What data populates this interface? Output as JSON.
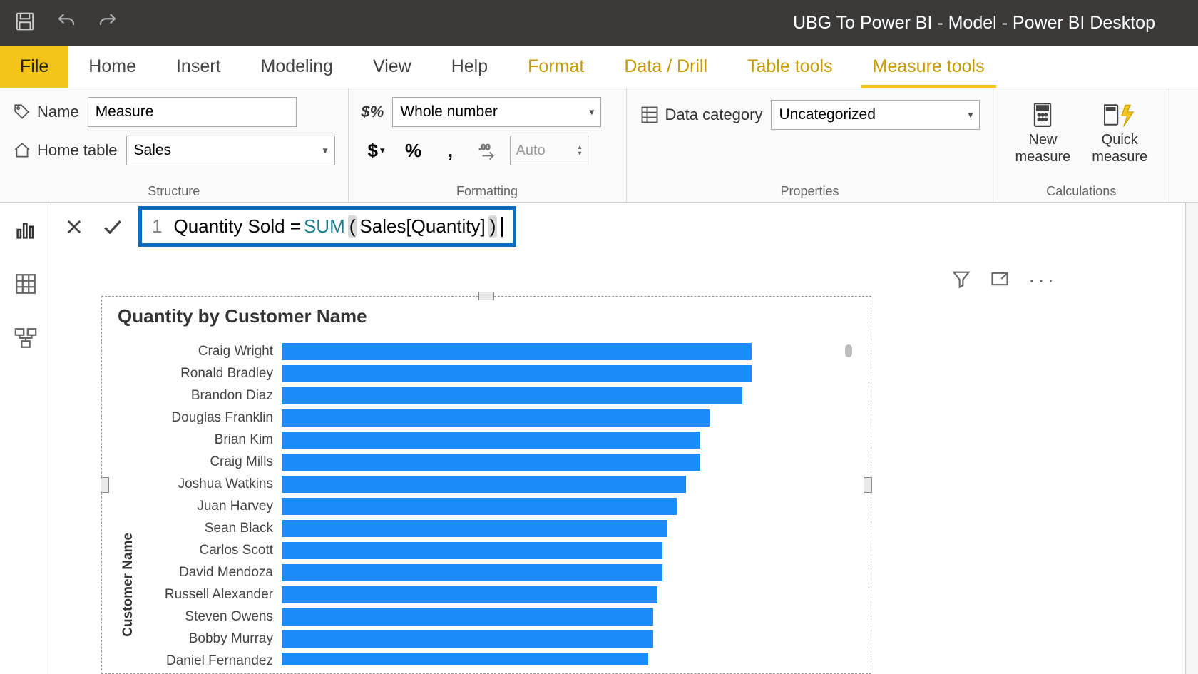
{
  "window_title": "UBG To Power BI - Model - Power BI Desktop",
  "ribbon_tabs": {
    "file": "File",
    "home": "Home",
    "insert": "Insert",
    "modeling": "Modeling",
    "view": "View",
    "help": "Help",
    "format": "Format",
    "data_drill": "Data / Drill",
    "table_tools": "Table tools",
    "measure_tools": "Measure tools"
  },
  "ribbon": {
    "structure": {
      "label": "Structure",
      "name_label": "Name",
      "name_value": "Measure",
      "home_table_label": "Home table",
      "home_table_value": "Sales"
    },
    "formatting": {
      "label": "Formatting",
      "format_value": "Whole number",
      "decimals_placeholder": "Auto"
    },
    "properties": {
      "label": "Properties",
      "data_category_label": "Data category",
      "data_category_value": "Uncategorized"
    },
    "calculations": {
      "label": "Calculations",
      "new_measure": "New\nmeasure",
      "quick_measure": "Quick\nmeasure"
    }
  },
  "formula": {
    "line_no": "1",
    "text_before_fn": "Quantity Sold = ",
    "fn": "SUM",
    "open": "(",
    "arg": " Sales[Quantity] ",
    "close": ")"
  },
  "chart_data": {
    "type": "bar",
    "title": "Quantity by Customer Name",
    "ylabel": "Customer Name",
    "xlabel": "",
    "categories": [
      "Craig Wright",
      "Ronald Bradley",
      "Brandon Diaz",
      "Douglas Franklin",
      "Brian Kim",
      "Craig Mills",
      "Joshua Watkins",
      "Juan Harvey",
      "Sean Black",
      "Carlos Scott",
      "David Mendoza",
      "Russell Alexander",
      "Steven Owens",
      "Bobby Murray",
      "Daniel Fernandez"
    ],
    "values": [
      100,
      100,
      98,
      91,
      89,
      89,
      86,
      84,
      82,
      81,
      81,
      80,
      79,
      79,
      78
    ],
    "ylim": [
      0,
      100
    ]
  }
}
